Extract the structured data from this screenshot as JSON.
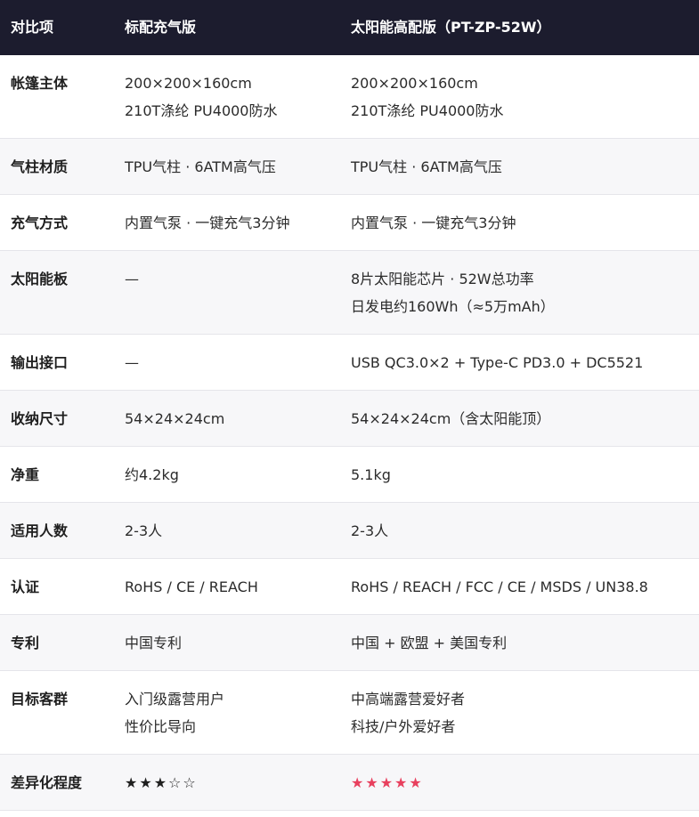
{
  "header": {
    "col1": "对比项",
    "col2": "标配充气版",
    "col3": "太阳能高配版（PT-ZP-52W）"
  },
  "rows": [
    {
      "label": "帐篷主体",
      "std": [
        "200×200×160cm",
        "210T涤纶 PU4000防水"
      ],
      "pro": [
        "200×200×160cm",
        "210T涤纶 PU4000防水"
      ]
    },
    {
      "label": "气柱材质",
      "std": [
        "TPU气柱 · 6ATM高气压"
      ],
      "pro": [
        "TPU气柱 · 6ATM高气压"
      ]
    },
    {
      "label": "充气方式",
      "std": [
        "内置气泵 · 一键充气3分钟"
      ],
      "pro": [
        "内置气泵 · 一键充气3分钟"
      ]
    },
    {
      "label": "太阳能板",
      "std": [
        "—"
      ],
      "pro": [
        "8片太阳能芯片 · 52W总功率",
        "日发电约160Wh（≈5万mAh）"
      ]
    },
    {
      "label": "输出接口",
      "std": [
        "—"
      ],
      "pro": [
        "USB QC3.0×2 + Type-C PD3.0 + DC5521"
      ]
    },
    {
      "label": "收纳尺寸",
      "std": [
        "54×24×24cm"
      ],
      "pro": [
        "54×24×24cm（含太阳能顶）"
      ]
    },
    {
      "label": "净重",
      "std": [
        "约4.2kg"
      ],
      "pro": [
        "5.1kg"
      ]
    },
    {
      "label": "适用人数",
      "std": [
        "2-3人"
      ],
      "pro": [
        "2-3人"
      ]
    },
    {
      "label": "认证",
      "std": [
        "RoHS / CE / REACH"
      ],
      "pro": [
        "RoHS / REACH / FCC / CE / MSDS / UN38.8"
      ]
    },
    {
      "label": "专利",
      "std": [
        "中国专利"
      ],
      "pro": [
        "中国 + 欧盟 + 美国专利"
      ]
    },
    {
      "label": "目标客群",
      "std": [
        "入门级露营用户",
        "性价比导向"
      ],
      "pro": [
        "中高端露营爱好者",
        "科技/户外爱好者"
      ]
    },
    {
      "label": "差异化程度",
      "std": [
        "★★★☆☆"
      ],
      "pro": [
        "★★★★★"
      ]
    }
  ],
  "colors": {
    "header_bg": "#1c1c2e",
    "alt_row_bg": "#f7f7f9",
    "star_accent": "#e8405e"
  }
}
